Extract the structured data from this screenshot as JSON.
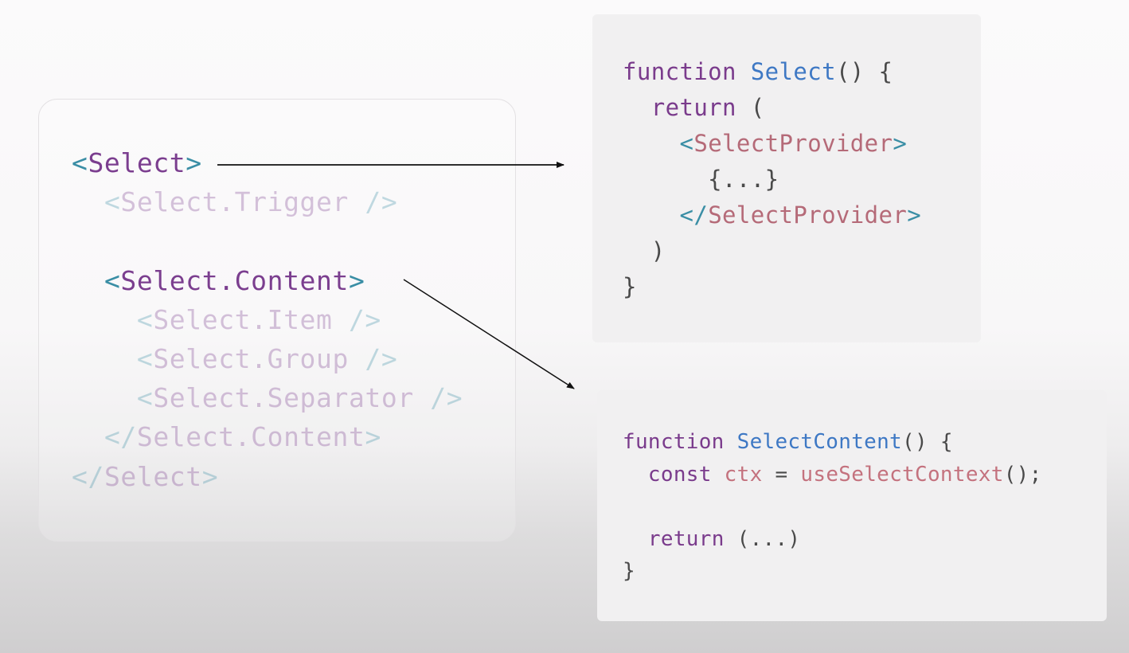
{
  "jsx_tree": {
    "select_open": {
      "lt": "<",
      "name": "Select",
      "gt": ">"
    },
    "trigger": {
      "lt": "<",
      "name": "Select.Trigger",
      "close": " />"
    },
    "content_open": {
      "lt": "<",
      "name": "Select.Content",
      "gt": ">"
    },
    "item": {
      "lt": "<",
      "name": "Select.Item",
      "close": " />"
    },
    "group": {
      "lt": "<",
      "name": "Select.Group",
      "close": " />"
    },
    "separator": {
      "lt": "<",
      "name": "Select.Separator",
      "close": " />"
    },
    "content_close": {
      "lt": "</",
      "name": "Select.Content",
      "gt": ">"
    },
    "select_close": {
      "lt": "</",
      "name": "Select",
      "gt": ">"
    }
  },
  "select_component": {
    "keyword": "function",
    "name": "Select",
    "signature": "() {",
    "return_kw": "return",
    "return_open": " (",
    "provider_open_lt": "<",
    "provider_name": "SelectProvider",
    "provider_open_gt": ">",
    "children": "{...}",
    "provider_close_lt": "</",
    "provider_close_gt": ">",
    "paren_close": ")",
    "brace_close": "}"
  },
  "select_content_component": {
    "keyword": "function",
    "name": "SelectContent",
    "signature": "() {",
    "const_kw": "const",
    "var_name": "ctx",
    "assign": " = ",
    "hook_call": "useSelectContext",
    "call_end": "();",
    "return_kw": "return",
    "return_rest": " (...)",
    "brace_close": "}"
  },
  "colors": {
    "tag_bracket": "#3a8ea5",
    "jsx_name": "#7b3e8f",
    "keyword": "#7a3b8c",
    "function_name": "#3e78c4",
    "component_tag": "#b56a78"
  }
}
